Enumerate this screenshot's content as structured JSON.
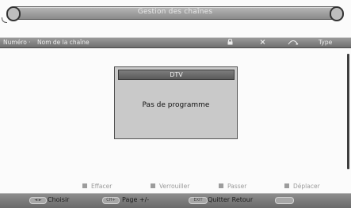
{
  "window": {
    "title": "Gestion des chaînes"
  },
  "header": {
    "number_label": "Numéro",
    "name_label": "Nom de la chaîne",
    "lock_icon": "lock-icon",
    "delete_icon": "x-icon",
    "skip_icon": "skip-icon",
    "type_label": "Type"
  },
  "dialog": {
    "title": "DTV",
    "message": "Pas de programme"
  },
  "legend": {
    "items": [
      {
        "label": "Effacer"
      },
      {
        "label": "Verrouiller"
      },
      {
        "label": "Passer"
      },
      {
        "label": "Déplacer"
      }
    ]
  },
  "footer": {
    "select_key": "◄ ►",
    "select_label": "Choisir",
    "page_key": "CH+",
    "page_label": "Page +/-",
    "exit_key": "EXIT",
    "exit_label": "Quitter Retour"
  }
}
